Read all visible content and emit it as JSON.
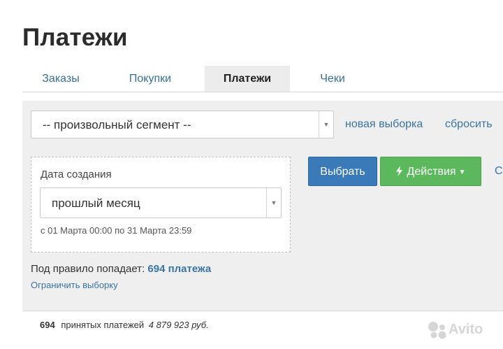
{
  "page": {
    "title": "Платежи"
  },
  "tabs": [
    {
      "label": "Заказы",
      "active": false
    },
    {
      "label": "Покупки",
      "active": false
    },
    {
      "label": "Платежи",
      "active": true
    },
    {
      "label": "Чеки",
      "active": false
    }
  ],
  "filter": {
    "segment_value": "-- произвольный сегмент --",
    "new_selection_link": "новая выборка",
    "reset_link": "сбросить",
    "date_label": "Дата создания",
    "period_value": "прошлый месяц",
    "date_range": "с 01 Марта 00:00 по 31 Марта 23:59",
    "select_button": "Выбрать",
    "actions_button": "Действия",
    "cut_link_fragment": "С",
    "rule_prefix": "Под правило попадает:",
    "rule_count": "694 платежа",
    "limit_link": "Ограничить выборку"
  },
  "summary": {
    "count": "694",
    "label": "принятых платежей",
    "amount": "4 879 923 руб."
  },
  "watermark": {
    "text": "Avito"
  },
  "icons": {
    "dropdown_arrow": "chevron-down-icon",
    "actions_bolt": "lightning-icon",
    "actions_caret": "caret-down-icon"
  },
  "colors": {
    "link": "#3a74a3",
    "primary_button": "#3a7ab8",
    "success_button": "#5cb85c",
    "panel_bg": "#efefef"
  }
}
